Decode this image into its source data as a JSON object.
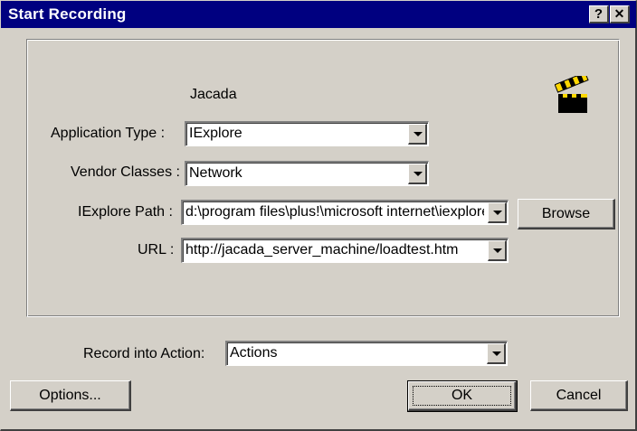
{
  "window": {
    "title": "Start Recording",
    "help_label": "?",
    "close_label": "✕"
  },
  "panel": {
    "heading": "Jacada",
    "icon": "clapperboard-icon",
    "fields": {
      "application_type": {
        "label": "Application Type :",
        "value": "IExplore"
      },
      "vendor_classes": {
        "label": "Vendor Classes :",
        "value": "Network"
      },
      "iexplore_path": {
        "label": "IExplore Path :",
        "value": "d:\\program files\\plus!\\microsoft internet\\iexplore.exe"
      },
      "url": {
        "label": "URL :",
        "value": "http://jacada_server_machine/loadtest.htm"
      }
    },
    "browse_label": "Browse"
  },
  "record_into": {
    "label": "Record into Action:",
    "value": "Actions"
  },
  "buttons": {
    "options": "Options...",
    "ok": "OK",
    "cancel": "Cancel"
  },
  "colors": {
    "title_bar": "#000080",
    "face": "#d4d0c8"
  }
}
